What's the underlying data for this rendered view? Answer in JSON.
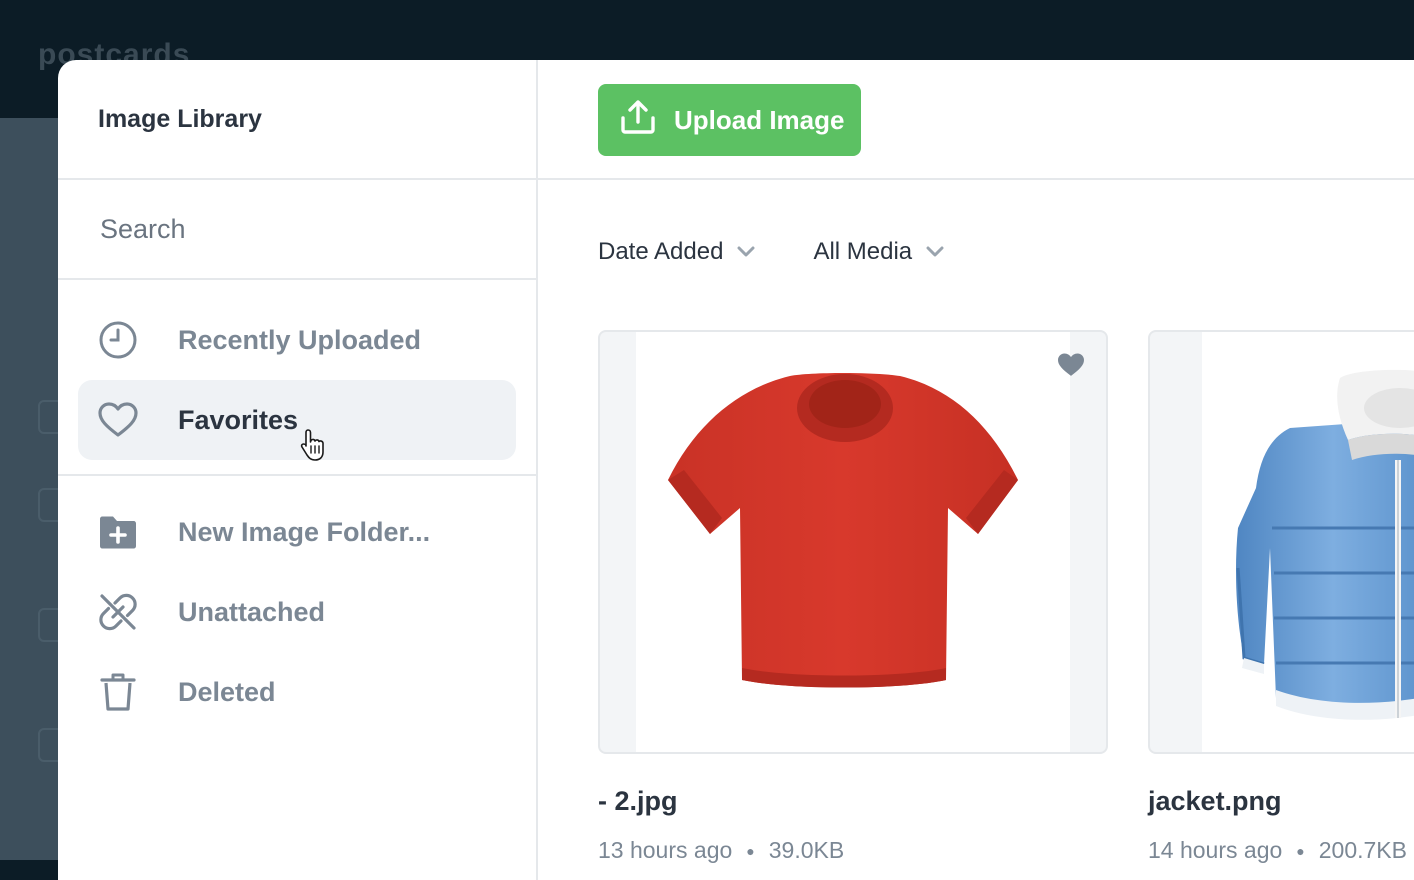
{
  "app": {
    "logo_text": "postcards"
  },
  "library": {
    "title": "Image Library",
    "search_placeholder": "Search"
  },
  "nav": {
    "primary": [
      {
        "label": "Recently Uploaded",
        "icon": "clock-icon",
        "active": false
      },
      {
        "label": "Favorites",
        "icon": "heart-outline-icon",
        "active": true
      }
    ],
    "secondary": [
      {
        "label": "New Image Folder...",
        "icon": "folder-plus-icon"
      },
      {
        "label": "Unattached",
        "icon": "unlink-icon"
      },
      {
        "label": "Deleted",
        "icon": "trash-icon"
      }
    ]
  },
  "toolbar": {
    "upload_label": "Upload Image"
  },
  "filters": {
    "sort": "Date Added",
    "media": "All Media"
  },
  "images": [
    {
      "name": "- 2.jpg",
      "time": "13 hours ago",
      "size": "39.0KB",
      "favorite": true
    },
    {
      "name": "jacket.png",
      "time": "14 hours ago",
      "size": "200.7KB",
      "favorite": false
    }
  ],
  "colors": {
    "accent_green": "#5cc163",
    "selected_bg": "#eff2f5",
    "text_dark": "#2b3440",
    "text_muted": "#7b8794",
    "divider": "#e5e8eb"
  }
}
